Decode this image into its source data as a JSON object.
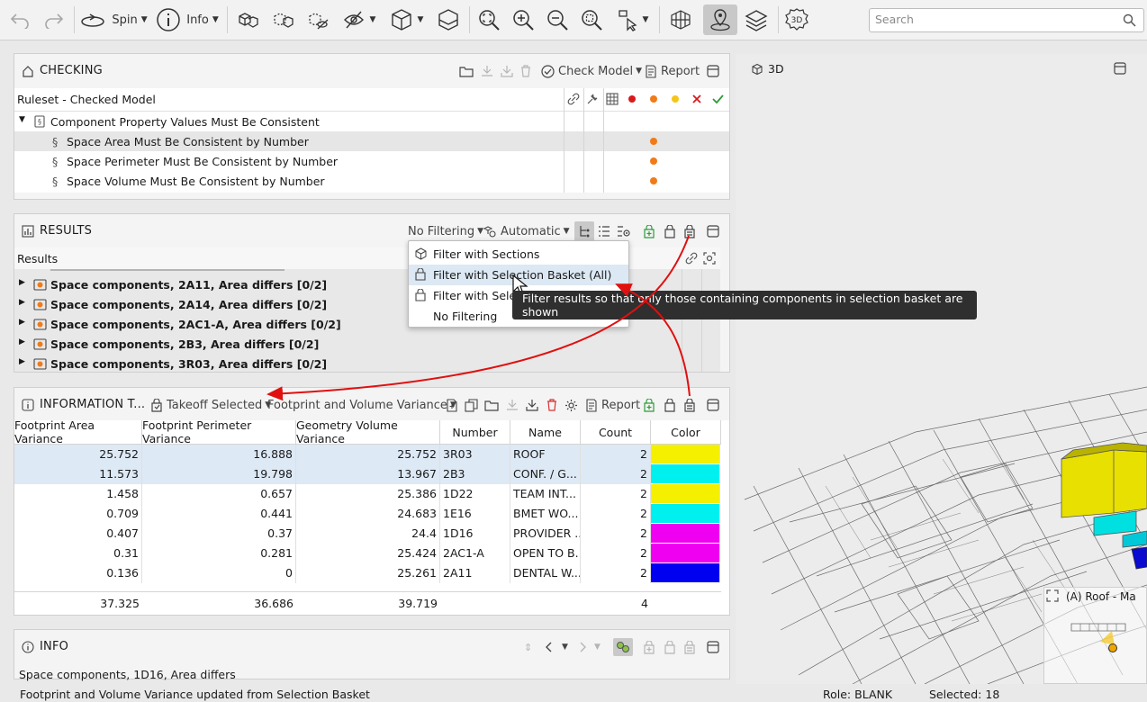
{
  "toolbar": {
    "spin_label": "Spin",
    "info_label": "Info",
    "view_3d_label": "3D",
    "search_placeholder": "Search"
  },
  "checking": {
    "title": "CHECKING",
    "check_model_label": "Check Model",
    "report_label": "Report",
    "column_title": "Ruleset - Checked Model",
    "severity_colors": [
      "#d7191c",
      "#f07b18",
      "#f5c518"
    ],
    "rows": [
      {
        "label": "Component Property Values Must Be Consistent",
        "level": 0,
        "dot": false
      },
      {
        "label": "Space Area Must Be Consistent by Number",
        "level": 1,
        "dot": true
      },
      {
        "label": "Space Perimeter Must Be Consistent by Number",
        "level": 1,
        "dot": true
      },
      {
        "label": "Space Volume Must Be Consistent by Number",
        "level": 1,
        "dot": true
      }
    ]
  },
  "results": {
    "title": "RESULTS",
    "filter_label": "No Filtering",
    "mode_label": "Automatic",
    "column_title": "Results",
    "rows": [
      {
        "label": "Space components, 2A11, Area differs [0/2]"
      },
      {
        "label": "Space components, 2A14, Area differs [0/2]"
      },
      {
        "label": "Space components, 2AC1-A, Area differs [0/2]"
      },
      {
        "label": "Space components, 2B3, Area differs [0/2]"
      },
      {
        "label": "Space components, 3R03, Area differs [0/2]"
      }
    ]
  },
  "filter_menu": {
    "items": [
      {
        "label": "Filter with Sections"
      },
      {
        "label": "Filter with Selection Basket (All)"
      },
      {
        "label": "Filter with Selec"
      },
      {
        "label": "No Filtering"
      }
    ],
    "tooltip": "Filter results so that only those containing components in selection basket are shown"
  },
  "information": {
    "title": "INFORMATION T...",
    "takeoff_label": "Takeoff Selected",
    "variance_label": "Footprint and Volume Variance",
    "report_label": "Report",
    "columns": [
      "Footprint Area Variance",
      "Footprint Perimeter Variance",
      "Geometry Volume Variance",
      "Number",
      "Name",
      "Count",
      "Color"
    ],
    "rows": [
      {
        "area": "25.752",
        "perimeter": "16.888",
        "volume": "25.752",
        "number": "3R03",
        "name": "ROOF",
        "count": "2",
        "color": "#f5ef00",
        "selected": true
      },
      {
        "area": "11.573",
        "perimeter": "19.798",
        "volume": "13.967",
        "number": "2B3",
        "name": "CONF. / G...",
        "count": "2",
        "color": "#00f0f0",
        "selected": true
      },
      {
        "area": "1.458",
        "perimeter": "0.657",
        "volume": "25.386",
        "number": "1D22",
        "name": "TEAM INT...",
        "count": "2",
        "color": "#f5ef00",
        "selected": false
      },
      {
        "area": "0.709",
        "perimeter": "0.441",
        "volume": "24.683",
        "number": "1E16",
        "name": "BMET WO...",
        "count": "2",
        "color": "#00f0f0",
        "selected": false
      },
      {
        "area": "0.407",
        "perimeter": "0.37",
        "volume": "24.4",
        "number": "1D16",
        "name": "PROVIDER ...",
        "count": "2",
        "color": "#f000f0",
        "selected": false
      },
      {
        "area": "0.31",
        "perimeter": "0.281",
        "volume": "25.424",
        "number": "2AC1-A",
        "name": "OPEN TO B...",
        "count": "2",
        "color": "#f000f0",
        "selected": false
      },
      {
        "area": "0.136",
        "perimeter": "0",
        "volume": "25.261",
        "number": "2A11",
        "name": "DENTAL W...",
        "count": "2",
        "color": "#0000f0",
        "selected": false
      }
    ],
    "totals": {
      "area": "37.325",
      "perimeter": "36.686",
      "volume": "39.719",
      "count": "4"
    }
  },
  "info_panel": {
    "title": "INFO",
    "text": "Space components, 1D16, Area differs"
  },
  "view3d": {
    "title": "3D",
    "level_label": "(A) Roof - Ma"
  },
  "status": {
    "message": "Footprint and Volume Variance updated from Selection Basket",
    "role": "Role: BLANK",
    "selected": "Selected: 18"
  }
}
